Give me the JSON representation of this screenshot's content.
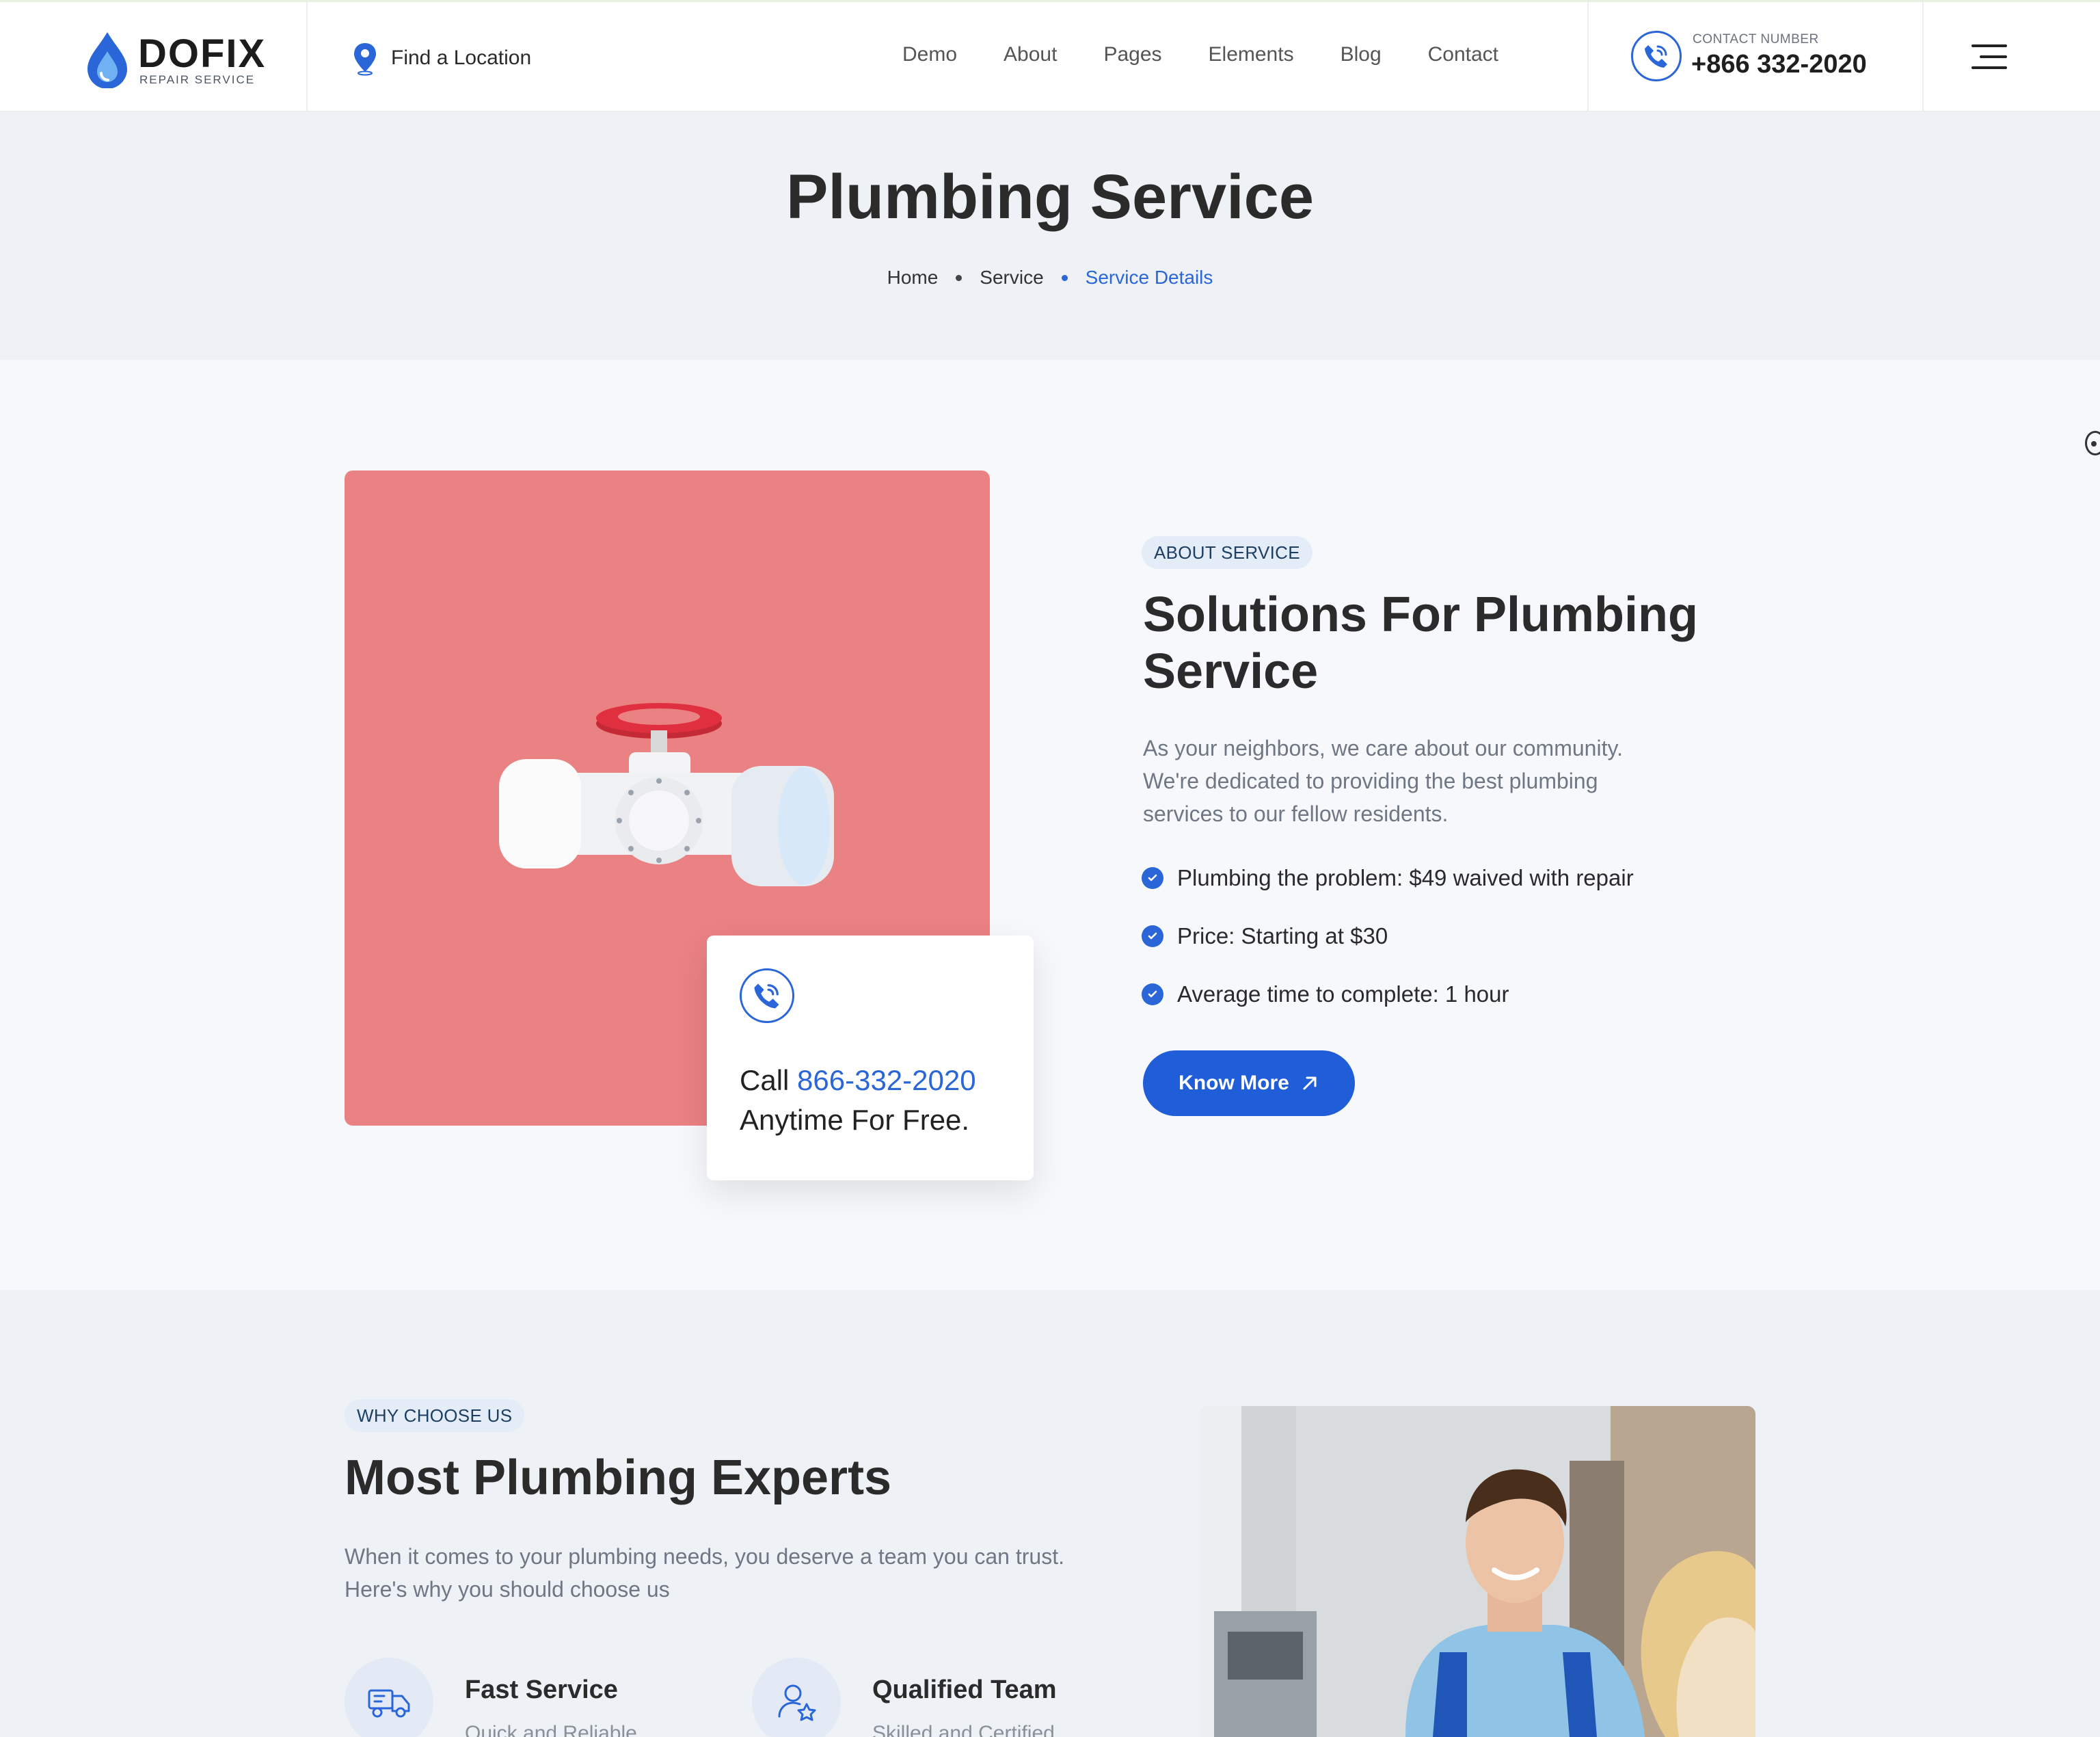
{
  "header": {
    "logo": {
      "word": "DOFIX",
      "sub": "REPAIR SERVICE"
    },
    "find_location": "Find a Location",
    "nav": [
      "Demo",
      "About",
      "Pages",
      "Elements",
      "Blog",
      "Contact"
    ],
    "contact_label": "CONTACT NUMBER",
    "contact_number": "+866 332-2020"
  },
  "page": {
    "title": "Plumbing Service",
    "breadcrumb": [
      "Home",
      "Service",
      "Service Details"
    ]
  },
  "about": {
    "tag": "ABOUT SERVICE",
    "title_line1": "Solutions For Plumbing",
    "title_line2": "Service",
    "para_line1": "As your neighbors, we care about our community.",
    "para_line2": "We're dedicated to providing the best plumbing",
    "para_line3": "services to our fellow residents.",
    "checks": [
      "Plumbing the problem: $49 waived with repair",
      "Price: Starting at $30",
      "Average time to complete: 1 hour"
    ],
    "button": "Know More",
    "call_prefix": "Call",
    "call_number": "866-332-2020",
    "call_suffix": "Anytime For Free."
  },
  "why": {
    "tag": "WHY CHOOSE US",
    "title": "Most Plumbing Experts",
    "para_line1": "When it comes to your plumbing needs, you deserve a team you can trust.",
    "para_line2": "Here's why you should choose us",
    "features": [
      {
        "title": "Fast Service",
        "subtitle": "Quick and Reliable",
        "icon": "truck-icon"
      },
      {
        "title": "Qualified Team",
        "subtitle": "Skilled and Certified",
        "icon": "user-star-icon"
      }
    ]
  },
  "colors": {
    "accent": "#1f5ed8",
    "pink_panel": "#ea8183",
    "valve_red": "#e0303f"
  }
}
